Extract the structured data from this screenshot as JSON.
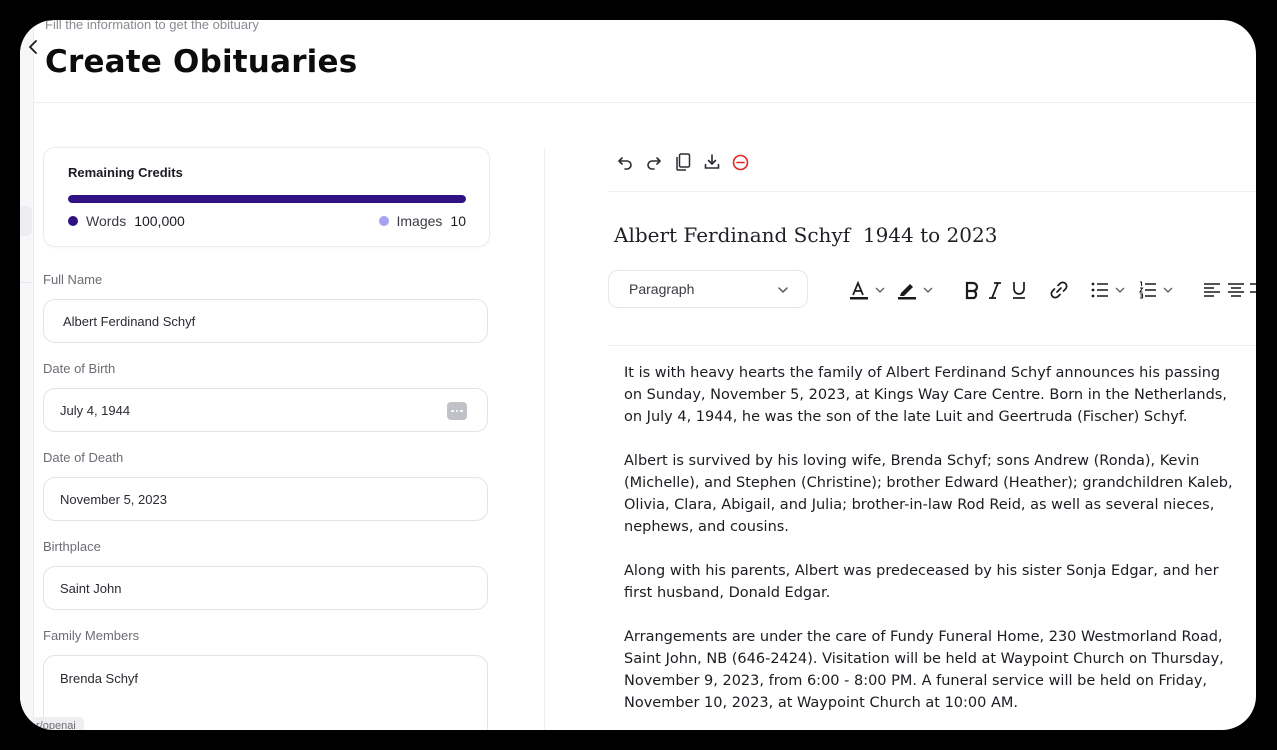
{
  "page": {
    "subtitle": "Fill the information to get the obituary",
    "title": "Create Obituaries"
  },
  "credits": {
    "title": "Remaining Credits",
    "words_label": "Words",
    "words_value": "100,000",
    "images_label": "Images",
    "images_value": "10",
    "remaining_fraction": 1.0,
    "colors": {
      "words": "#2f1182",
      "images": "#a9a2f0"
    }
  },
  "form": {
    "full_name": {
      "label": "Full Name",
      "value": "Albert Ferdinand Schyf"
    },
    "date_of_birth": {
      "label": "Date of Birth",
      "value": "July 4, 1944"
    },
    "date_of_death": {
      "label": "Date of Death",
      "value": "November 5, 2023"
    },
    "birthplace": {
      "label": "Birthplace",
      "value": "Saint John"
    },
    "family_members": {
      "label": "Family Members",
      "value": "Brenda Schyf"
    }
  },
  "source_tag": "r/openai",
  "editor": {
    "toolbar_icons": [
      "undo-icon",
      "redo-icon",
      "copy-icon",
      "download-icon",
      "remove-icon"
    ],
    "obituary_title": "Albert Ferdinand Schyf  1944 to 2023",
    "block_type": "Paragraph",
    "paragraphs": [
      "It is with heavy hearts the family of Albert Ferdinand Schyf announces his passing on Sunday, November 5, 2023, at Kings Way Care Centre. Born in the Netherlands, on July 4, 1944, he was the son of the late Luit and Geertruda (Fischer) Schyf.",
      "Albert is survived by his loving wife, Brenda Schyf; sons Andrew (Ronda), Kevin (Michelle), and Stephen (Christine); brother Edward (Heather); grandchildren Kaleb, Olivia, Clara, Abigail, and Julia; brother-in-law Rod Reid, as well as several nieces, nephews, and cousins.",
      "Along with his parents, Albert was predeceased by his sister Sonja Edgar, and her first husband, Donald Edgar.",
      "Arrangements are under the care of Fundy Funeral Home, 230 Westmorland Road, Saint John, NB (646-2424). Visitation will be held at Waypoint Church on Thursday, November 9, 2023, from 6:00 - 8:00 PM. A funeral service will be held on Friday, November 10, 2023, at Waypoint Church at 10:00 AM."
    ]
  }
}
